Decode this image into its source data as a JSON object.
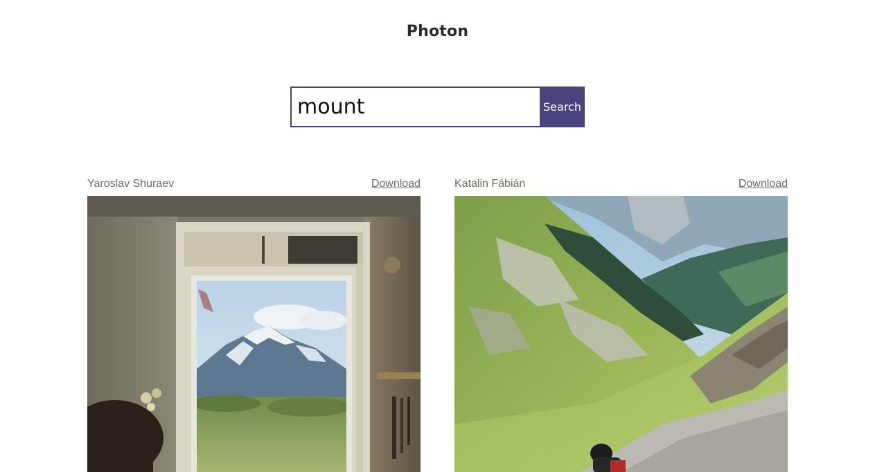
{
  "header": {
    "title": "Photon"
  },
  "search": {
    "value": "mount",
    "button_label": "Search"
  },
  "results": [
    {
      "photographer": "Yaroslav Shuraev",
      "download_label": "Download"
    },
    {
      "photographer": "Katalin Fábián",
      "download_label": "Download"
    }
  ],
  "colors": {
    "accent": "#4a4380",
    "muted_text": "#6b6b6b"
  }
}
